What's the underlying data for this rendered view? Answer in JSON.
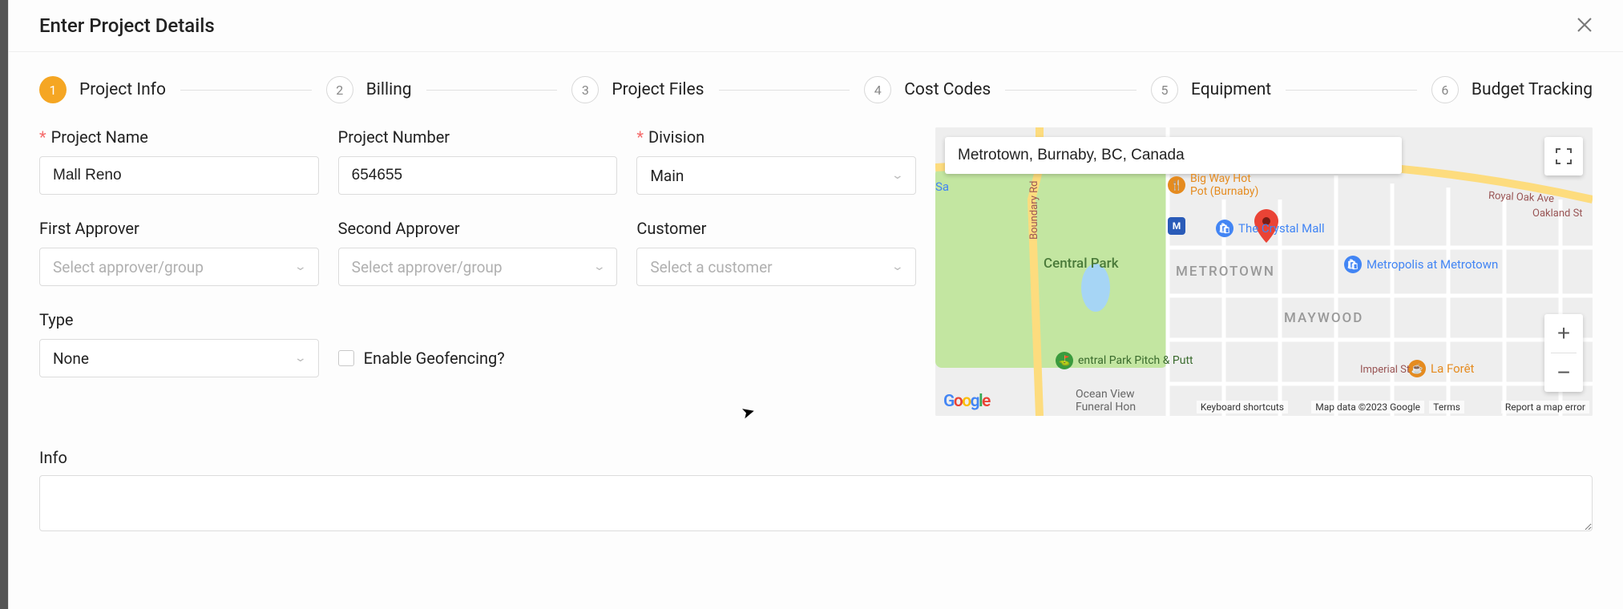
{
  "modal": {
    "title": "Enter Project Details"
  },
  "stepper": [
    {
      "num": "1",
      "label": "Project Info",
      "active": true
    },
    {
      "num": "2",
      "label": "Billing",
      "active": false
    },
    {
      "num": "3",
      "label": "Project Files",
      "active": false
    },
    {
      "num": "4",
      "label": "Cost Codes",
      "active": false
    },
    {
      "num": "5",
      "label": "Equipment",
      "active": false
    },
    {
      "num": "6",
      "label": "Budget Tracking",
      "active": false
    }
  ],
  "form": {
    "project_name": {
      "label": "Project Name",
      "value": "Mall Reno",
      "required": true
    },
    "project_number": {
      "label": "Project Number",
      "value": "654655",
      "required": false
    },
    "division": {
      "label": "Division",
      "value": "Main",
      "required": true
    },
    "first_approver": {
      "label": "First Approver",
      "placeholder": "Select approver/group"
    },
    "second_approver": {
      "label": "Second Approver",
      "placeholder": "Select approver/group"
    },
    "customer": {
      "label": "Customer",
      "placeholder": "Select a customer"
    },
    "type": {
      "label": "Type",
      "value": "None"
    },
    "geofencing": {
      "label": "Enable Geofencing?"
    },
    "info": {
      "label": "Info"
    }
  },
  "map": {
    "search_value": "Metrotown, Burnaby, BC, Canada",
    "labels": {
      "metrotown": "METROTOWN",
      "maywood": "MAYWOOD",
      "central_park": "Central Park",
      "pitch_putt": "entral Park Pitch & Putt",
      "crystal_mall": "The Crystal Mall",
      "metropolis": "Metropolis at Metrotown",
      "hot_pot": "Big Way Hot\nPot (Burnaby)",
      "la_foret": "La Forêt",
      "funeral": "Ocean View\nFuneral Hon",
      "imperial": "Imperial St",
      "royal_oak": "Royal Oak Ave",
      "oakland": "Oakland St",
      "sa": "Sa",
      "boundary": "Boundary Rd",
      "m_badge": "M"
    },
    "attribution": {
      "shortcuts": "Keyboard shortcuts",
      "data": "Map data ©2023 Google",
      "terms": "Terms",
      "report": "Report a map error"
    }
  }
}
